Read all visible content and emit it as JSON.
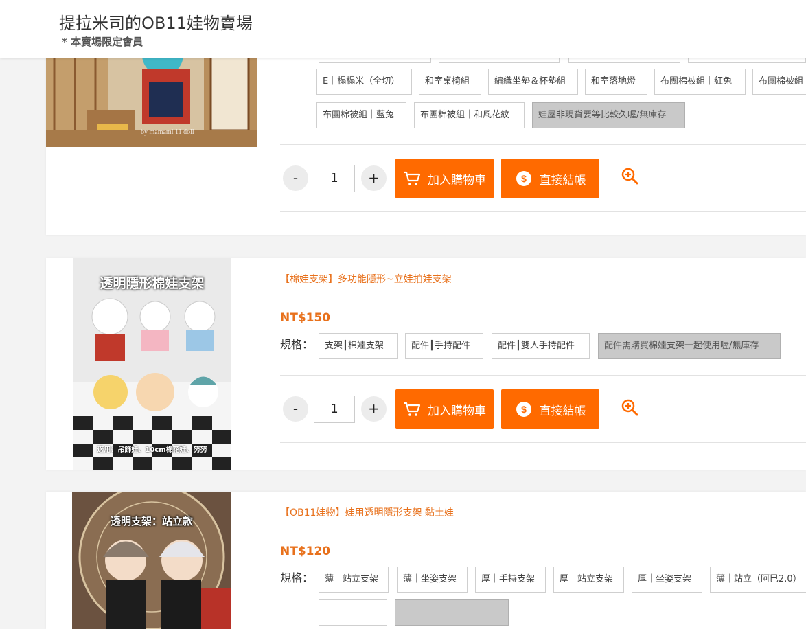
{
  "header": {
    "title": "提拉米司的OB11娃物賣場",
    "subtitle": "* 本賣場限定會員"
  },
  "icons": {
    "cart": "cart-icon",
    "checkout": "dollar-circle-icon",
    "zoom": "zoom-in-icon"
  },
  "colors": {
    "accent": "#ff6a00",
    "price": "#e8711c",
    "out_of_stock": "#c9c9c9"
  },
  "spec_label": "規格：",
  "buttons": {
    "minus": "-",
    "plus": "+",
    "add_to_cart": "加入購物車",
    "checkout": "直接結帳"
  },
  "products": [
    {
      "specs_row1": [
        "E｜榻榻米（全切）",
        "和室桌椅組",
        "編織坐墊＆杯墊組",
        "和室落地燈",
        "布團棉被組｜紅兔",
        "布團棉被組"
      ],
      "specs_row2": [
        "布團棉被組｜藍兔",
        "布團棉被組｜和風花紋",
        "娃屋非現貨要等比較久喔/無庫存"
      ],
      "photo_caption": "by mamami 11 doll",
      "quantity": "1"
    },
    {
      "name": "【棉娃支架】多功能隱形~立娃拍娃支架",
      "price": "NT$150",
      "specs": [
        "支架┃棉娃支架",
        "配件┃手持配件",
        "配件┃雙人手持配件",
        "配件需購買棉娃支架一起使用喔/無庫存"
      ],
      "photo_title": "透明隱形棉娃支架",
      "photo_caption": "適用：吊飾娃、10cm棉花娃、努努",
      "quantity": "1"
    },
    {
      "name": "【OB11娃物】娃用透明隱形支架 黏土娃",
      "price": "NT$120",
      "specs": [
        "薄｜站立支架",
        "薄｜坐姿支架",
        "厚｜手持支架",
        "厚｜站立支架",
        "厚｜坐姿支架",
        "薄｜站立（阿巳2.0）"
      ],
      "photo_title": "透明支架：站立款"
    }
  ]
}
